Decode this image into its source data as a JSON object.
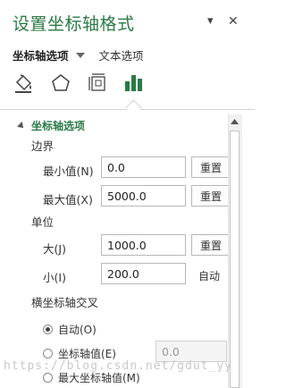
{
  "panel": {
    "title": "设置坐标轴格式",
    "close": "✕",
    "menu": "▾"
  },
  "tabs": {
    "axis_options": "坐标轴选项",
    "text_options": "文本选项"
  },
  "icons": [
    "fill-line-icon",
    "effects-pentagon-icon",
    "size-properties-icon",
    "axis-options-bar-chart-icon"
  ],
  "colors": {
    "accent": "#2a7a46"
  },
  "section": {
    "title": "坐标轴选项"
  },
  "bounds": {
    "label": "边界",
    "min_label": "最小值(N)",
    "min_value": "0.0",
    "max_label": "最大值(X)",
    "max_value": "5000.0",
    "reset": "重置"
  },
  "units": {
    "label": "单位",
    "major_label": "大(J)",
    "major_value": "1000.0",
    "minor_label": "小(I)",
    "minor_value": "200.0",
    "reset": "重置",
    "auto": "自动"
  },
  "cross": {
    "label": "横坐标轴交叉",
    "options": [
      "自动(O)",
      "坐标轴值(E)",
      "最大坐标轴值(M)"
    ],
    "selected": 0,
    "axis_value": "0.0"
  },
  "watermark": "https://blog.csdn.net/gdut_yy"
}
